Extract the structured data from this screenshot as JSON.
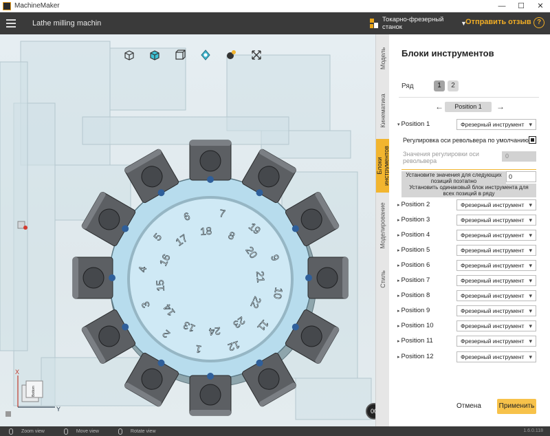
{
  "window": {
    "app_title": "MachineMaker",
    "minimize": "—",
    "maximize": "☐",
    "close": "✕"
  },
  "header": {
    "project_title": "Lathe milling machin",
    "machine_name": "Токарно-фрезерный станок",
    "feedback_label": "Отправить отзыв",
    "help_label": "?"
  },
  "viewport": {
    "play_label": "00",
    "cube_labels": [
      "Bottom"
    ],
    "turret_numbers": [
      "7",
      "8",
      "19",
      "20",
      "9",
      "21",
      "10",
      "22",
      "11",
      "23",
      "12",
      "24",
      "1",
      "13",
      "2",
      "14",
      "3",
      "15",
      "4",
      "16",
      "5",
      "17",
      "6",
      "18"
    ],
    "toolbar_icons": [
      "box-iso-icon",
      "box-top-icon",
      "box-front-icon",
      "fit-view-icon",
      "orbit-icon",
      "expand-icon"
    ]
  },
  "vtabs": [
    {
      "label": "Модель",
      "active": false
    },
    {
      "label": "Кинематика",
      "active": false
    },
    {
      "label": "Блоки инструментов",
      "active": true
    },
    {
      "label": "Моделирование",
      "active": false
    },
    {
      "label": "Стиль",
      "active": false
    }
  ],
  "panel": {
    "title": "Блоки инструментов",
    "row_label": "Ряд",
    "row_buttons": [
      "1",
      "2"
    ],
    "nav_prev": "←",
    "nav_next": "→",
    "current_position": "Position 1",
    "default_axis_label": "Регулировка оси револьвера по умолчанию",
    "adjust_label": "Значения регулировки оси револьвера",
    "adjust_value": "0",
    "set_next_label": "Установите значения для следующих позиций поэтапно",
    "set_next_value": "0",
    "same_block_label": "Установить одинаковый блок инструмента для всех позиций в ряду",
    "positions": [
      {
        "label": "Position 1",
        "tool": "Фрезерный инструмент"
      },
      {
        "label": "Position 2",
        "tool": "Фрезерный инструмент"
      },
      {
        "label": "Position 3",
        "tool": "Фрезерный инструмент"
      },
      {
        "label": "Position 4",
        "tool": "Фрезерный инструмент"
      },
      {
        "label": "Position 5",
        "tool": "Фрезерный инструмент"
      },
      {
        "label": "Position 6",
        "tool": "Фрезерный инструмент"
      },
      {
        "label": "Position 7",
        "tool": "Фрезерный инструмент"
      },
      {
        "label": "Position 8",
        "tool": "Фрезерный инструмент"
      },
      {
        "label": "Position 9",
        "tool": "Фрезерный инструмент"
      },
      {
        "label": "Position 10",
        "tool": "Фрезерный инструмент"
      },
      {
        "label": "Position 11",
        "tool": "Фрезерный инструмент"
      },
      {
        "label": "Position 12",
        "tool": "Фрезерный инструмент"
      }
    ],
    "cancel_label": "Отмена",
    "apply_label": "Применить"
  },
  "statusbar": {
    "hints": [
      "Zoom view",
      "Move view",
      "Rotate view"
    ],
    "version": "1.6.0.118"
  },
  "colors": {
    "accent": "#f2b52f",
    "header_bg": "#3a3a3a",
    "feedback": "#f2ae25",
    "turret_face": "#bde0ef",
    "tool_block": "#5c5f63",
    "marker": "#2f5f9a"
  }
}
